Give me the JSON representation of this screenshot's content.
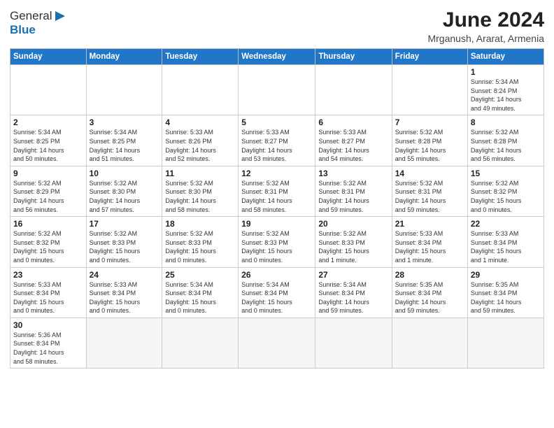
{
  "header": {
    "logo_general": "General",
    "logo_blue": "Blue",
    "month_title": "June 2024",
    "subtitle": "Mrganush, Ararat, Armenia"
  },
  "calendar": {
    "days_of_week": [
      "Sunday",
      "Monday",
      "Tuesday",
      "Wednesday",
      "Thursday",
      "Friday",
      "Saturday"
    ],
    "weeks": [
      [
        {
          "day": "",
          "info": ""
        },
        {
          "day": "",
          "info": ""
        },
        {
          "day": "",
          "info": ""
        },
        {
          "day": "",
          "info": ""
        },
        {
          "day": "",
          "info": ""
        },
        {
          "day": "",
          "info": ""
        },
        {
          "day": "1",
          "info": "Sunrise: 5:34 AM\nSunset: 8:24 PM\nDaylight: 14 hours\nand 49 minutes."
        }
      ],
      [
        {
          "day": "2",
          "info": "Sunrise: 5:34 AM\nSunset: 8:25 PM\nDaylight: 14 hours\nand 50 minutes."
        },
        {
          "day": "3",
          "info": "Sunrise: 5:34 AM\nSunset: 8:25 PM\nDaylight: 14 hours\nand 51 minutes."
        },
        {
          "day": "4",
          "info": "Sunrise: 5:33 AM\nSunset: 8:26 PM\nDaylight: 14 hours\nand 52 minutes."
        },
        {
          "day": "5",
          "info": "Sunrise: 5:33 AM\nSunset: 8:27 PM\nDaylight: 14 hours\nand 53 minutes."
        },
        {
          "day": "6",
          "info": "Sunrise: 5:33 AM\nSunset: 8:27 PM\nDaylight: 14 hours\nand 54 minutes."
        },
        {
          "day": "7",
          "info": "Sunrise: 5:32 AM\nSunset: 8:28 PM\nDaylight: 14 hours\nand 55 minutes."
        },
        {
          "day": "8",
          "info": "Sunrise: 5:32 AM\nSunset: 8:28 PM\nDaylight: 14 hours\nand 56 minutes."
        }
      ],
      [
        {
          "day": "9",
          "info": "Sunrise: 5:32 AM\nSunset: 8:29 PM\nDaylight: 14 hours\nand 56 minutes."
        },
        {
          "day": "10",
          "info": "Sunrise: 5:32 AM\nSunset: 8:30 PM\nDaylight: 14 hours\nand 57 minutes."
        },
        {
          "day": "11",
          "info": "Sunrise: 5:32 AM\nSunset: 8:30 PM\nDaylight: 14 hours\nand 58 minutes."
        },
        {
          "day": "12",
          "info": "Sunrise: 5:32 AM\nSunset: 8:31 PM\nDaylight: 14 hours\nand 58 minutes."
        },
        {
          "day": "13",
          "info": "Sunrise: 5:32 AM\nSunset: 8:31 PM\nDaylight: 14 hours\nand 59 minutes."
        },
        {
          "day": "14",
          "info": "Sunrise: 5:32 AM\nSunset: 8:31 PM\nDaylight: 14 hours\nand 59 minutes."
        },
        {
          "day": "15",
          "info": "Sunrise: 5:32 AM\nSunset: 8:32 PM\nDaylight: 15 hours\nand 0 minutes."
        }
      ],
      [
        {
          "day": "16",
          "info": "Sunrise: 5:32 AM\nSunset: 8:32 PM\nDaylight: 15 hours\nand 0 minutes."
        },
        {
          "day": "17",
          "info": "Sunrise: 5:32 AM\nSunset: 8:33 PM\nDaylight: 15 hours\nand 0 minutes."
        },
        {
          "day": "18",
          "info": "Sunrise: 5:32 AM\nSunset: 8:33 PM\nDaylight: 15 hours\nand 0 minutes."
        },
        {
          "day": "19",
          "info": "Sunrise: 5:32 AM\nSunset: 8:33 PM\nDaylight: 15 hours\nand 0 minutes."
        },
        {
          "day": "20",
          "info": "Sunrise: 5:32 AM\nSunset: 8:33 PM\nDaylight: 15 hours\nand 1 minute."
        },
        {
          "day": "21",
          "info": "Sunrise: 5:33 AM\nSunset: 8:34 PM\nDaylight: 15 hours\nand 1 minute."
        },
        {
          "day": "22",
          "info": "Sunrise: 5:33 AM\nSunset: 8:34 PM\nDaylight: 15 hours\nand 1 minute."
        }
      ],
      [
        {
          "day": "23",
          "info": "Sunrise: 5:33 AM\nSunset: 8:34 PM\nDaylight: 15 hours\nand 0 minutes."
        },
        {
          "day": "24",
          "info": "Sunrise: 5:33 AM\nSunset: 8:34 PM\nDaylight: 15 hours\nand 0 minutes."
        },
        {
          "day": "25",
          "info": "Sunrise: 5:34 AM\nSunset: 8:34 PM\nDaylight: 15 hours\nand 0 minutes."
        },
        {
          "day": "26",
          "info": "Sunrise: 5:34 AM\nSunset: 8:34 PM\nDaylight: 15 hours\nand 0 minutes."
        },
        {
          "day": "27",
          "info": "Sunrise: 5:34 AM\nSunset: 8:34 PM\nDaylight: 14 hours\nand 59 minutes."
        },
        {
          "day": "28",
          "info": "Sunrise: 5:35 AM\nSunset: 8:34 PM\nDaylight: 14 hours\nand 59 minutes."
        },
        {
          "day": "29",
          "info": "Sunrise: 5:35 AM\nSunset: 8:34 PM\nDaylight: 14 hours\nand 59 minutes."
        }
      ],
      [
        {
          "day": "30",
          "info": "Sunrise: 5:36 AM\nSunset: 8:34 PM\nDaylight: 14 hours\nand 58 minutes."
        },
        {
          "day": "",
          "info": ""
        },
        {
          "day": "",
          "info": ""
        },
        {
          "day": "",
          "info": ""
        },
        {
          "day": "",
          "info": ""
        },
        {
          "day": "",
          "info": ""
        },
        {
          "day": "",
          "info": ""
        }
      ]
    ]
  }
}
